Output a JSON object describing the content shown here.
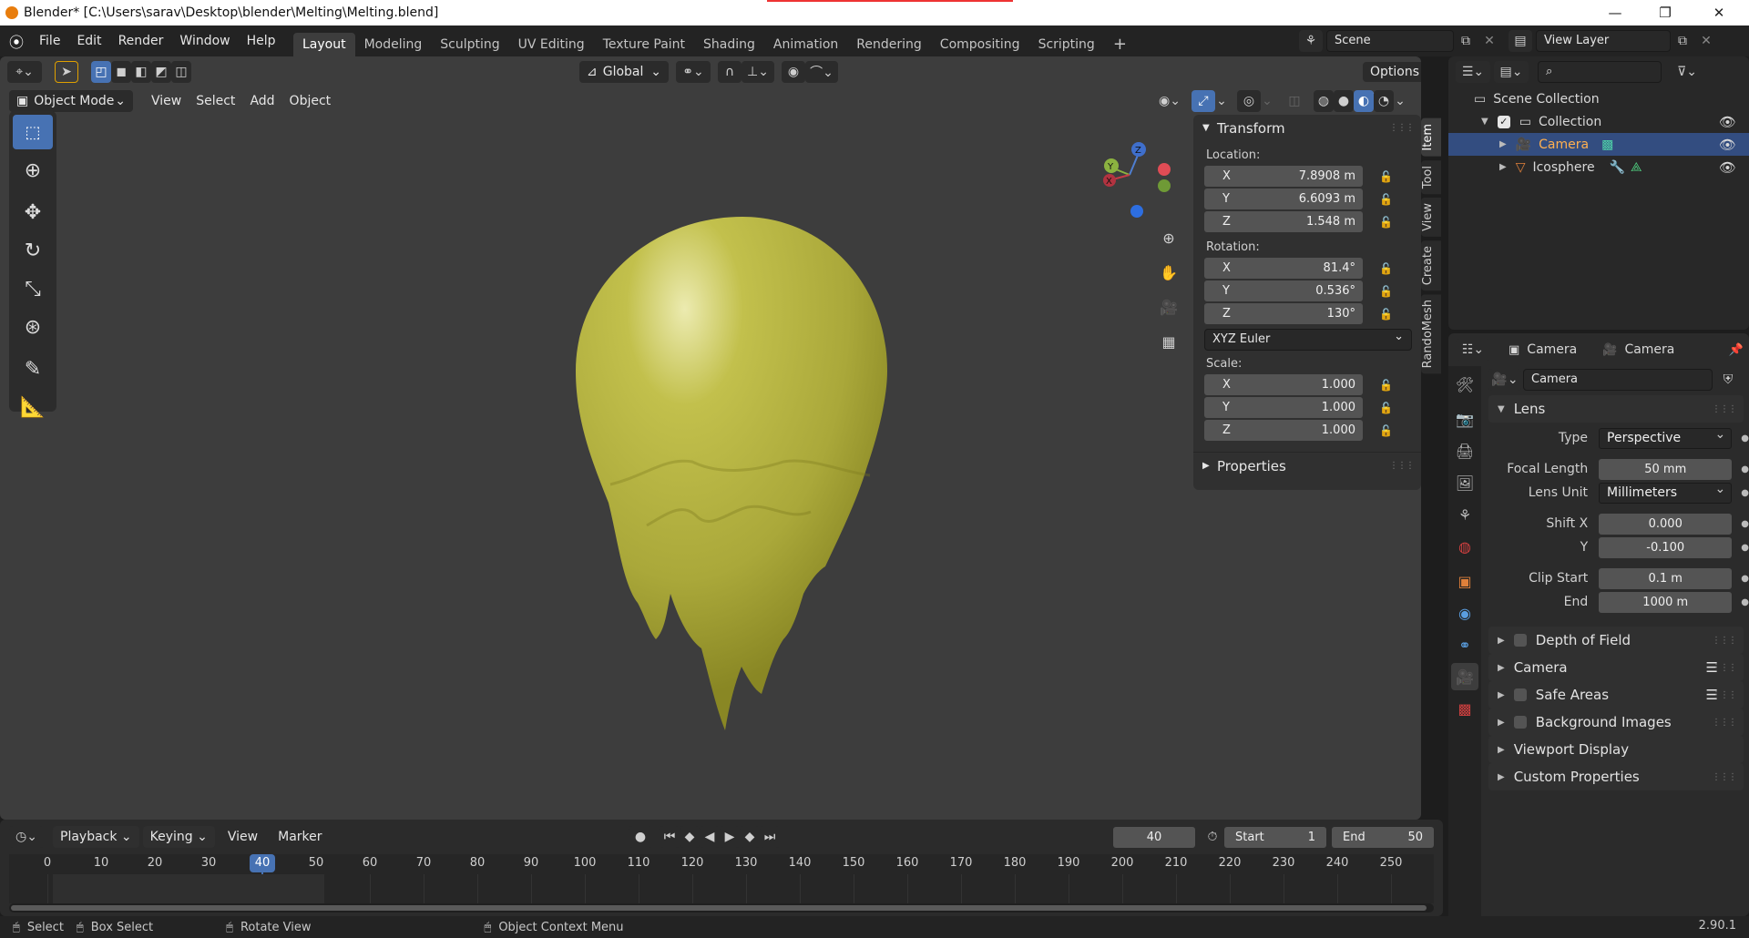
{
  "titlebar": {
    "title": "Blender* [C:\\Users\\sarav\\Desktop\\blender\\Melting\\Melting.blend]"
  },
  "menu": [
    "File",
    "Edit",
    "Render",
    "Window",
    "Help"
  ],
  "workspaces": [
    "Layout",
    "Modeling",
    "Sculpting",
    "UV Editing",
    "Texture Paint",
    "Shading",
    "Animation",
    "Rendering",
    "Compositing",
    "Scripting"
  ],
  "active_workspace": "Layout",
  "scene": {
    "name": "Scene",
    "view_layer": "View Layer"
  },
  "viewport": {
    "mode": "Object Mode",
    "menus": [
      "View",
      "Select",
      "Add",
      "Object"
    ],
    "orientation": "Global",
    "options_label": "Options",
    "object_color": "#b7b541",
    "bg_color": "#3d3d3d",
    "gizmo": {
      "x": "X",
      "y": "Y",
      "z": "Z"
    }
  },
  "npanel": {
    "header": "Transform",
    "location_label": "Location:",
    "location": [
      {
        "axis": "X",
        "value": "7.8908 m"
      },
      {
        "axis": "Y",
        "value": "6.6093 m"
      },
      {
        "axis": "Z",
        "value": "1.548 m"
      }
    ],
    "rotation_label": "Rotation:",
    "rotation": [
      {
        "axis": "X",
        "value": "81.4°"
      },
      {
        "axis": "Y",
        "value": "0.536°"
      },
      {
        "axis": "Z",
        "value": "130°"
      }
    ],
    "rotation_mode": "XYZ Euler",
    "scale_label": "Scale:",
    "scale": [
      {
        "axis": "X",
        "value": "1.000"
      },
      {
        "axis": "Y",
        "value": "1.000"
      },
      {
        "axis": "Z",
        "value": "1.000"
      }
    ],
    "properties_label": "Properties",
    "tabs": [
      "Item",
      "Tool",
      "View",
      "Create",
      "RandoMesh"
    ]
  },
  "timeline": {
    "menus": [
      "Playback",
      "Keying",
      "View",
      "Marker"
    ],
    "current_frame": "40",
    "start_label": "Start",
    "start": "1",
    "end_label": "End",
    "end": "50",
    "ticks": [
      "0",
      "10",
      "20",
      "30",
      "40",
      "50",
      "60",
      "70",
      "80",
      "90",
      "100",
      "110",
      "120",
      "130",
      "140",
      "150",
      "160",
      "170",
      "180",
      "190",
      "200",
      "210",
      "220",
      "230",
      "240",
      "250"
    ],
    "current_frame_value": 40
  },
  "statusbar": {
    "select": "Select",
    "box_select": "Box Select",
    "rotate_view": "Rotate View",
    "context_menu": "Object Context Menu",
    "version": "2.90.1"
  },
  "outliner": {
    "scene_collection": "Scene Collection",
    "collection": "Collection",
    "items": [
      {
        "name": "Camera",
        "selected": true
      },
      {
        "name": "Icosphere",
        "selected": false
      }
    ]
  },
  "properties": {
    "breadcrumb_object": "Camera",
    "breadcrumb_data": "Camera",
    "data_name": "Camera",
    "lens_panel": "Lens",
    "type_label": "Type",
    "type_value": "Perspective",
    "focal_label": "Focal Length",
    "focal_value": "50 mm",
    "lens_unit_label": "Lens Unit",
    "lens_unit_value": "Millimeters",
    "shiftx_label": "Shift X",
    "shiftx_value": "0.000",
    "shifty_label": "Y",
    "shifty_value": "-0.100",
    "clipstart_label": "Clip Start",
    "clipstart_value": "0.1 m",
    "clipend_label": "End",
    "clipend_value": "1000 m",
    "panels": [
      "Depth of Field",
      "Camera",
      "Safe Areas",
      "Background Images",
      "Viewport Display",
      "Custom Properties"
    ]
  }
}
